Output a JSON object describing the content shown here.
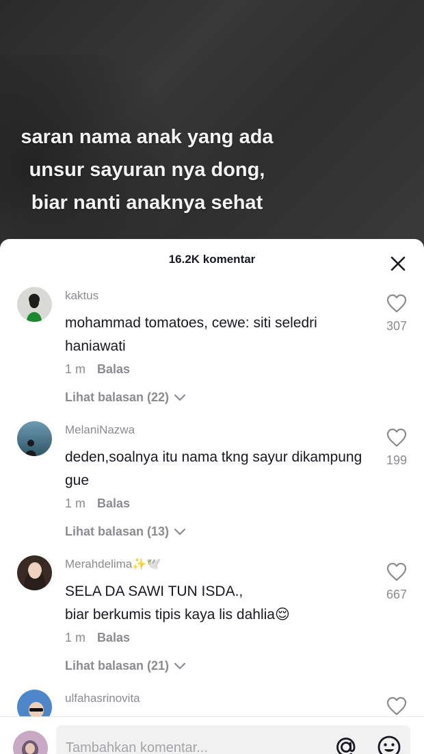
{
  "video": {
    "caption_lines": [
      "saran nama anak yang ada",
      "unsur sayuran nya dong,",
      "biar nanti anaknya sehat"
    ]
  },
  "sheet": {
    "title": "16.2K komentar"
  },
  "comments": [
    {
      "username": "kaktus",
      "text": "mohammad tomatoes, cewe: siti seledri haniawati",
      "time": "1 m",
      "reply_label": "Balas",
      "view_replies": "Lihat balasan (22)",
      "likes": "307"
    },
    {
      "username": "MelaniNazwa",
      "text": "deden,soalnya itu nama tkng sayur dikampung gue",
      "time": "1 m",
      "reply_label": "Balas",
      "view_replies": "Lihat balasan (13)",
      "likes": "199"
    },
    {
      "username": "Merahdelima✨🕊️",
      "text": "SELA DA SAWI TUN ISDA.,\nbiar berkumis tipis kaya lis dahlia😌",
      "time": "1 m",
      "reply_label": "Balas",
      "view_replies": "Lihat balasan (21)",
      "likes": "667"
    },
    {
      "username": "ulfahasrinovita"
    }
  ],
  "input": {
    "placeholder": "Tambahkan komentar..."
  },
  "icons": {
    "close": "close-icon",
    "like": "heart-outline-icon",
    "at": "at-sign-icon",
    "emoji": "emoji-icon",
    "chevron": "chevron-down-icon"
  },
  "colors": {
    "text_primary": "#161823",
    "text_secondary": "#8a8b91",
    "input_bg": "#f1f1f2"
  }
}
